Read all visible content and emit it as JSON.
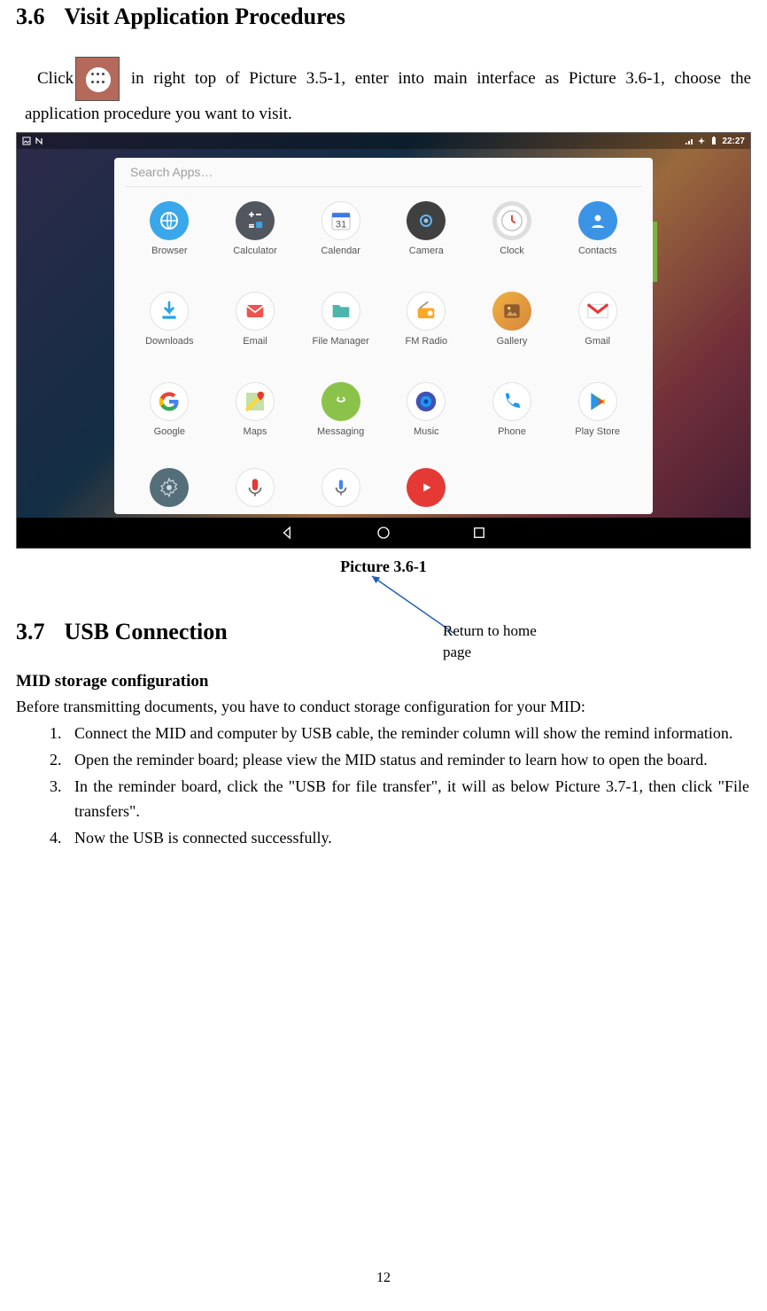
{
  "section36": {
    "number": "3.6",
    "title": "Visit Application Procedures",
    "intro_pre": "Click",
    "intro_post": " in right top of Picture 3.5-1, enter into main interface as Picture 3.6-1, choose the application procedure you want to visit.",
    "caption": "Picture 3.6-1",
    "annotation": "Return to home page"
  },
  "screenshot": {
    "status_time": "22:27",
    "search_placeholder": "Search Apps…",
    "apps": [
      {
        "label": "Browser",
        "icon": "browser-icon"
      },
      {
        "label": "Calculator",
        "icon": "calculator-icon"
      },
      {
        "label": "Calendar",
        "icon": "calendar-icon"
      },
      {
        "label": "Camera",
        "icon": "camera-icon"
      },
      {
        "label": "Clock",
        "icon": "clock-icon"
      },
      {
        "label": "Contacts",
        "icon": "contacts-icon"
      },
      {
        "label": "Downloads",
        "icon": "downloads-icon"
      },
      {
        "label": "Email",
        "icon": "email-icon"
      },
      {
        "label": "File Manager",
        "icon": "file-manager-icon"
      },
      {
        "label": "FM Radio",
        "icon": "fm-radio-icon"
      },
      {
        "label": "Gallery",
        "icon": "gallery-icon"
      },
      {
        "label": "Gmail",
        "icon": "gmail-icon"
      },
      {
        "label": "Google",
        "icon": "google-icon"
      },
      {
        "label": "Maps",
        "icon": "maps-icon"
      },
      {
        "label": "Messaging",
        "icon": "messaging-icon"
      },
      {
        "label": "Music",
        "icon": "music-icon"
      },
      {
        "label": "Phone",
        "icon": "phone-icon"
      },
      {
        "label": "Play Store",
        "icon": "play-store-icon"
      }
    ],
    "apps_row4": [
      {
        "label": "",
        "icon": "settings-icon"
      },
      {
        "label": "",
        "icon": "recorder-icon"
      },
      {
        "label": "",
        "icon": "voice-icon"
      },
      {
        "label": "",
        "icon": "youtube-icon"
      }
    ],
    "nav": {
      "back": "◁",
      "home": "◯",
      "recent": "☐"
    }
  },
  "section37": {
    "number": "3.7",
    "title": "USB Connection",
    "subhead": "MID storage configuration",
    "lead": "Before transmitting documents, you have to conduct storage configuration for your MID:",
    "items": [
      "Connect the MID and computer by USB cable, the reminder column will show the remind information.",
      "Open the reminder board; please view the MID status and reminder to learn how to open the board.",
      "In the reminder board, click the \"USB for file transfer\", it will as below Picture 3.7-1, then click \"File transfers\".",
      "Now the USB is connected successfully."
    ]
  },
  "page_number": "12"
}
